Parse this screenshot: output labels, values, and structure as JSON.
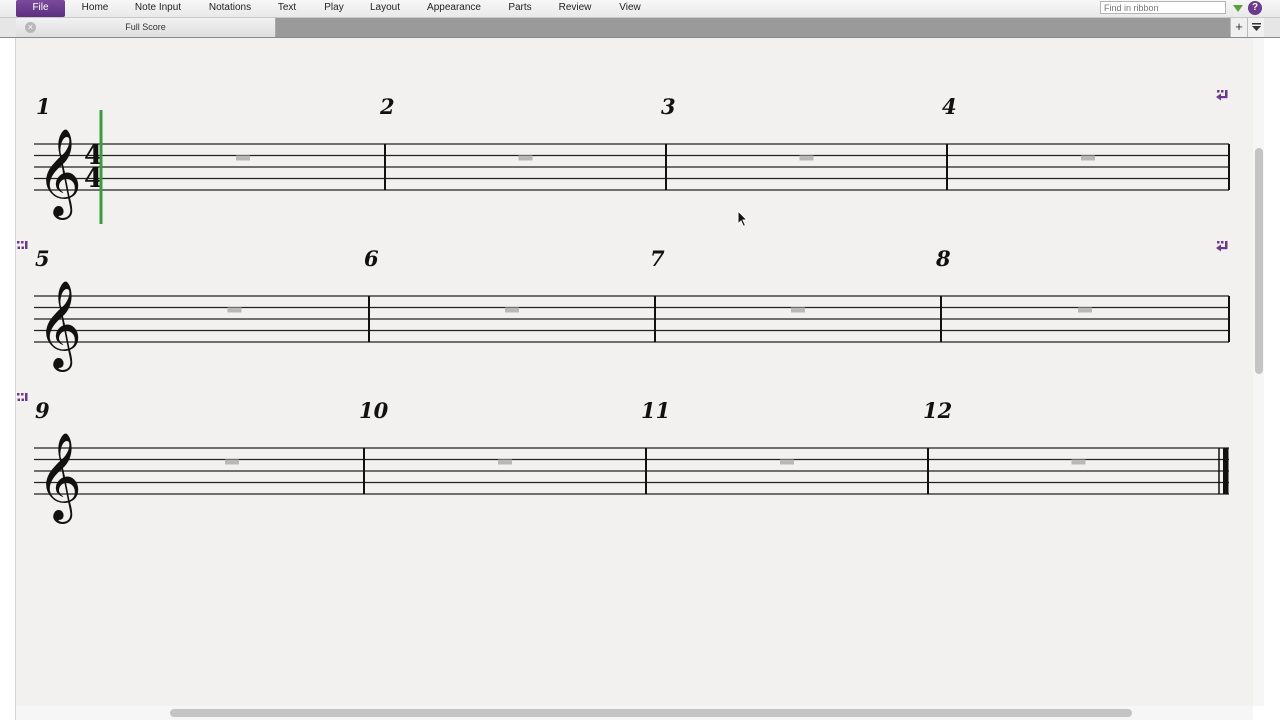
{
  "ribbon": {
    "tabs": [
      "File",
      "Home",
      "Note Input",
      "Notations",
      "Text",
      "Play",
      "Layout",
      "Appearance",
      "Parts",
      "Review",
      "View"
    ],
    "search_placeholder": "Find in ribbon",
    "help": "?"
  },
  "document_tabs": {
    "active_label": "Full Score",
    "add_label": "+"
  },
  "score": {
    "time_signature": {
      "top": "4",
      "bottom": "4"
    },
    "systems": [
      {
        "measures": [
          "1",
          "2",
          "3",
          "4"
        ],
        "time_signature": true,
        "final_barline": false
      },
      {
        "measures": [
          "5",
          "6",
          "7",
          "8"
        ],
        "time_signature": false,
        "final_barline": false
      },
      {
        "measures": [
          "9",
          "10",
          "11",
          "12"
        ],
        "time_signature": false,
        "final_barline": true
      }
    ],
    "colors": {
      "accent": "#6b3a8f",
      "caret": "#3d9a3d",
      "rest": "#b8b8b8"
    }
  }
}
